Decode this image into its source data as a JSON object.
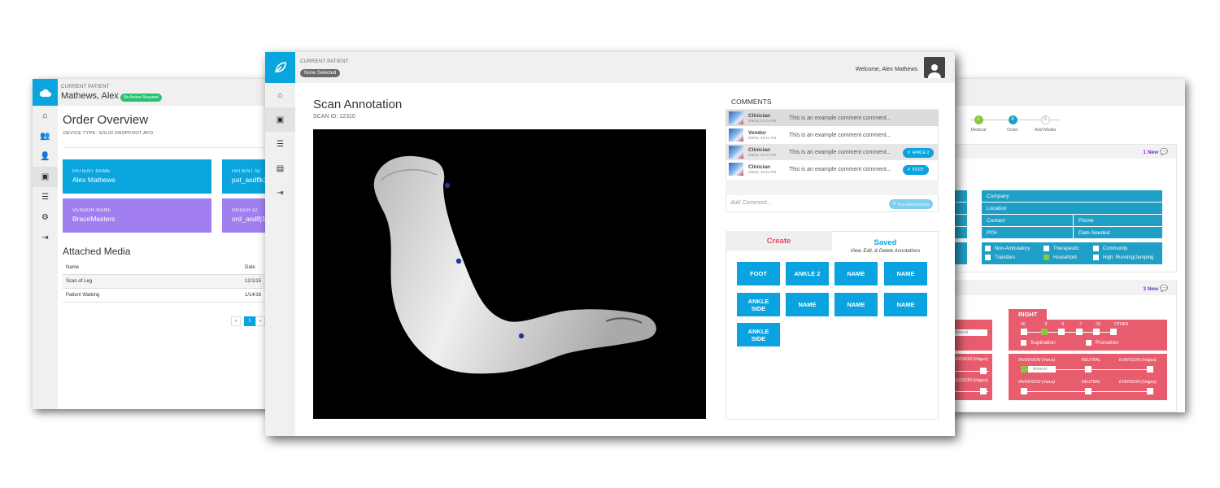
{
  "left_window": {
    "current_patient_label": "CURRENT PATIENT",
    "patient_name": "Mathews, Alex",
    "status_badge": "No Action Required",
    "title": "Order Overview",
    "device_type": "DEVICE TYPE: SOLID DROPFOOT AFO",
    "cards": [
      {
        "key": "PATIENT NAME",
        "value": "Alex Mathews",
        "color": "#0ba5dd"
      },
      {
        "key": "PATIENT ID",
        "value": "pat_asdflk1",
        "color": "#0ba5dd"
      },
      {
        "key": "VENDOR NAME",
        "value": "BraceMasters",
        "color": "#a17ff0"
      },
      {
        "key": "ORDER ID",
        "value": "ord_asdlfj1",
        "color": "#a17ff0"
      }
    ],
    "media_title": "Attached Media",
    "media_headers": [
      "Name",
      "Date"
    ],
    "media_rows": [
      {
        "name": "Scan of Leg",
        "date": "12/1/15"
      },
      {
        "name": "Patient Walking",
        "date": "1/14/16"
      }
    ],
    "pagination": {
      "prev": "«",
      "page": "1",
      "next": "»"
    }
  },
  "main_window": {
    "current_patient_label": "CURRENT PATIENT",
    "none_selected": "None Selected",
    "welcome": "Welcome, Alex Mathews",
    "title": "Scan Annotation",
    "scan_id": "SCAN ID: 12310",
    "comments_title": "COMMENTS",
    "comments": [
      {
        "author": "Clinician",
        "time": "2/9/16, 10:11 PM",
        "text": "This is an example comment comment...",
        "tag": ""
      },
      {
        "author": "Vendor",
        "time": "2/9/16, 10:11 PM",
        "text": "This is an example comment comment...",
        "tag": ""
      },
      {
        "author": "Clinician",
        "time": "2/9/16, 10:11 PM",
        "text": "This is an example comment comment...",
        "tag": "ANKLE 2"
      },
      {
        "author": "Clinician",
        "time": "2/9/16, 10:11 PM",
        "text": "This is an example comment comment...",
        "tag": "FOOT"
      }
    ],
    "add_comment_placeholder": "Add Comment...",
    "tag_annotation": "TAG ANNOTATION",
    "tab_create": "Create",
    "tab_saved": "Saved",
    "saved_hint": "View, Edit, & Delete Annotations",
    "annotations": [
      "FOOT",
      "ANKLE 2",
      "NAME",
      "NAME",
      "ANKLE SIDE",
      "NAME",
      "NAME",
      "NAME",
      "ANKLE SIDE"
    ]
  },
  "right_window": {
    "steps": [
      {
        "num": "✓",
        "label": "Medical",
        "state": "done"
      },
      {
        "num": "4",
        "label": "Order",
        "state": "active"
      },
      {
        "num": "5",
        "label": "Add Media",
        "state": "todo"
      }
    ],
    "new_count_1": "1 New",
    "new_count_2": "3 New",
    "fields": [
      "Company",
      "Location",
      "Contact",
      "Phone",
      "PO#",
      "Date Needed"
    ],
    "activity": [
      "Non-Ambulatory",
      "Therapeutic",
      "Community",
      "Transfers",
      "Household",
      "High: Running/Jumping"
    ],
    "right_label": "RIGHT",
    "left_amount": "Amount",
    "ticks": [
      "90",
      "-3",
      "-5",
      "-7",
      "-10",
      "OTHER"
    ],
    "supination": "Supination",
    "pronation": "Pronation",
    "inversion_varus": "INVERSION (Varus)",
    "neutral": "NEUTRAL",
    "eversion_valgus": "EVERSION (Valgus)",
    "eversion_left": "EVERSION (Valgus)",
    "amount": "Amount",
    "colors": {
      "blue": "#1f9fc5",
      "red": "#e85d6d",
      "purple": "#7b2fd6",
      "green": "#8cc63f"
    }
  }
}
